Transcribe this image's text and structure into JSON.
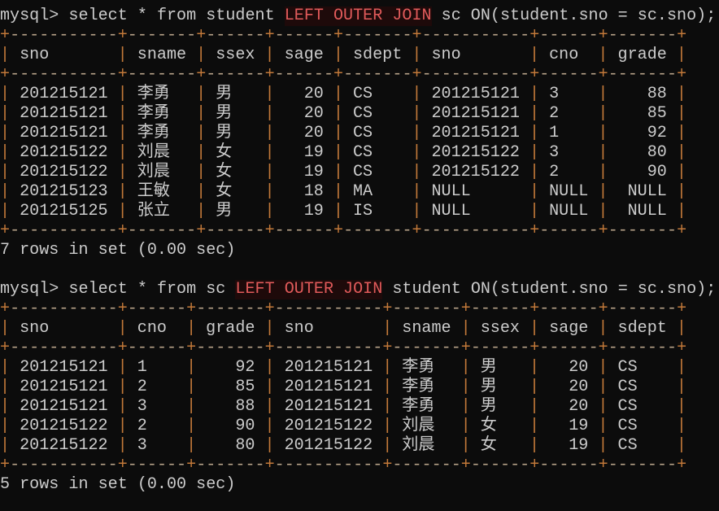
{
  "prompt": "mysql> ",
  "queries": [
    {
      "command_before": "select * from student ",
      "keyword": "LEFT OUTER JOIN",
      "command_after": " sc ON(student.sno = sc.sno);",
      "headers": [
        "sno",
        "sname",
        "ssex",
        "sage",
        "sdept",
        "sno",
        "cno",
        "grade"
      ],
      "rows": [
        [
          "201215121",
          "李勇",
          "男",
          "20",
          "CS",
          "201215121",
          "3",
          "88"
        ],
        [
          "201215121",
          "李勇",
          "男",
          "20",
          "CS",
          "201215121",
          "2",
          "85"
        ],
        [
          "201215121",
          "李勇",
          "男",
          "20",
          "CS",
          "201215121",
          "1",
          "92"
        ],
        [
          "201215122",
          "刘晨",
          "女",
          "19",
          "CS",
          "201215122",
          "3",
          "80"
        ],
        [
          "201215122",
          "刘晨",
          "女",
          "19",
          "CS",
          "201215122",
          "2",
          "90"
        ],
        [
          "201215123",
          "王敏",
          "女",
          "18",
          "MA",
          "NULL",
          "NULL",
          "NULL"
        ],
        [
          "201215125",
          "张立",
          "男",
          "19",
          "IS",
          "NULL",
          "NULL",
          "NULL"
        ]
      ],
      "summary": "7 rows in set (0.00 sec)"
    },
    {
      "command_before": "select * from sc ",
      "keyword": "LEFT OUTER JOIN",
      "command_after": " student ON(student.sno = sc.sno);",
      "headers": [
        "sno",
        "cno",
        "grade",
        "sno",
        "sname",
        "ssex",
        "sage",
        "sdept"
      ],
      "rows": [
        [
          "201215121",
          "1",
          "92",
          "201215121",
          "李勇",
          "男",
          "20",
          "CS"
        ],
        [
          "201215121",
          "2",
          "85",
          "201215121",
          "李勇",
          "男",
          "20",
          "CS"
        ],
        [
          "201215121",
          "3",
          "88",
          "201215121",
          "李勇",
          "男",
          "20",
          "CS"
        ],
        [
          "201215122",
          "2",
          "90",
          "201215122",
          "刘晨",
          "女",
          "19",
          "CS"
        ],
        [
          "201215122",
          "3",
          "80",
          "201215122",
          "刘晨",
          "女",
          "19",
          "CS"
        ]
      ],
      "summary": "5 rows in set (0.00 sec)"
    }
  ],
  "colors": {
    "background": "#0c0c0c",
    "text": "#cccccc",
    "keyword": "#e05a5a",
    "border": "#c47a3a"
  }
}
